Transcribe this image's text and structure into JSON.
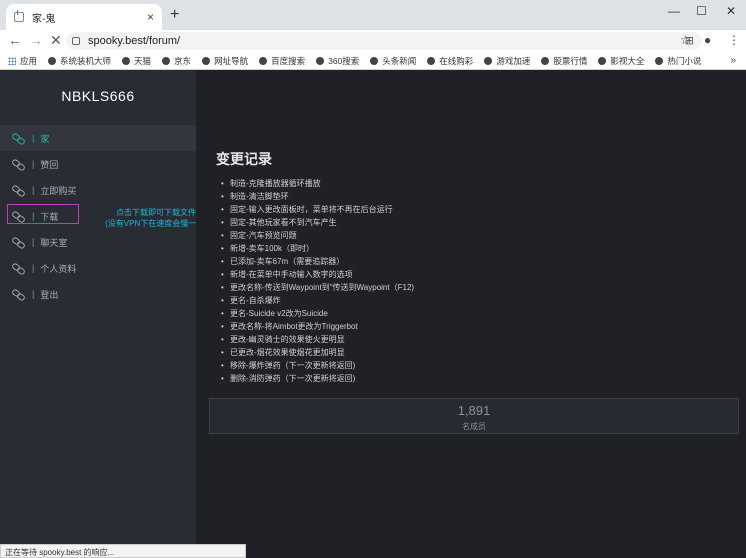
{
  "browser": {
    "tab_title": "家-鬼",
    "tab_close": "×",
    "new_tab": "+",
    "url": "spooky.best/forum/",
    "win_min": "—",
    "win_max": "☐",
    "win_close": "✕"
  },
  "bookmarks": [
    "应用",
    "系统装机大师",
    "天猫",
    "京东",
    "网址导航",
    "百度搜索",
    "360搜索",
    "头条新闻",
    "在线购彩",
    "游戏加速",
    "股票行情",
    "影视大全",
    "热门小说"
  ],
  "bookmarks_more": "»",
  "sidebar": {
    "brand": "NBKLS666",
    "items": [
      {
        "label": "家",
        "active": true
      },
      {
        "label": "赞回"
      },
      {
        "label": "立即购买"
      },
      {
        "label": "下载"
      },
      {
        "label": "聊天室"
      },
      {
        "label": "个人资料"
      },
      {
        "label": "登出"
      }
    ],
    "separator": "|"
  },
  "annotation": {
    "line1": "点击下载即可下载文件",
    "line2": "(没有VPN下在速度会慢一些)"
  },
  "main": {
    "heading": "变更记录",
    "changes": [
      "制造-克隆播放器循环播放",
      "制造-清洁脚垫环",
      "固定-输入更改面板时，菜单将不再在后台运行",
      "固定-其他玩家看不到汽车产生",
      "固定-汽车预览问题",
      "新增-卖车100k（即时）",
      "已添加-卖车67m（需要追踪器）",
      "新增-在菜单中手动输入数字的选项",
      "更改名称-传送到Waypoint到\"传送到Waypoint（F12)",
      "更名-自杀爆炸",
      "更名-Suicide v2改为Suicide",
      "更改名称-将Aimbot更改为Triggerbot",
      "更改-幽灵骑士的效果使火更明显",
      "已更改-烟花效果使烟花更加明显",
      "移除-爆炸弹药（下一次更新将返回)",
      "删除-消防弹药（下一次更新将返回)"
    ],
    "stat_value": "1,891",
    "stat_label": "名成员"
  },
  "status_text": "正在等待 spooky.best 的响应..."
}
